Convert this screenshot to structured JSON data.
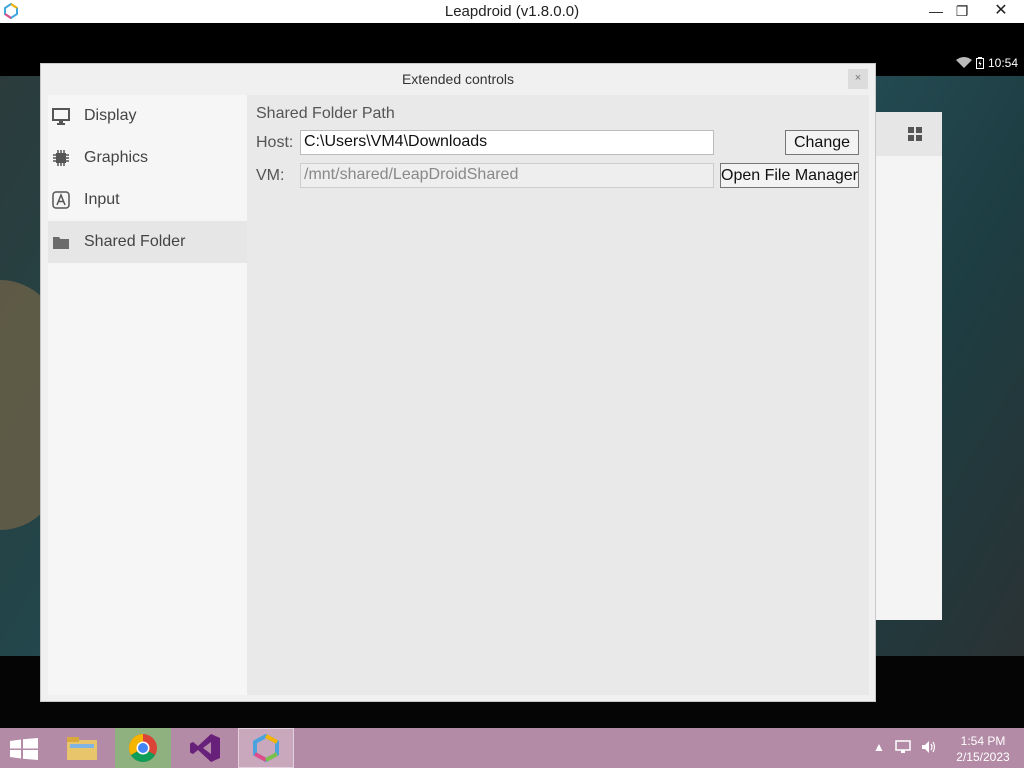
{
  "window": {
    "title": "Leapdroid (v1.8.0.0)"
  },
  "android": {
    "status_time": "10:54"
  },
  "dialog": {
    "title": "Extended controls",
    "close_label": "×",
    "nav": [
      {
        "label": "Display",
        "icon": "monitor-icon"
      },
      {
        "label": "Graphics",
        "icon": "chip-icon"
      },
      {
        "label": "Input",
        "icon": "input-icon"
      },
      {
        "label": "Shared Folder",
        "icon": "folder-icon",
        "active": true
      }
    ],
    "shared_folder": {
      "section_title": "Shared Folder Path",
      "host_label": "Host:",
      "host_value": "C:\\Users\\VM4\\Downloads",
      "vm_label": "VM:",
      "vm_value": "/mnt/shared/LeapDroidShared",
      "change_button": "Change",
      "open_button": "Open File Manager"
    }
  },
  "taskbar": {
    "apps": [
      "file-explorer-icon",
      "chrome-icon",
      "visual-studio-icon",
      "leapdroid-icon"
    ],
    "time": "1:54 PM",
    "date": "2/15/2023"
  }
}
